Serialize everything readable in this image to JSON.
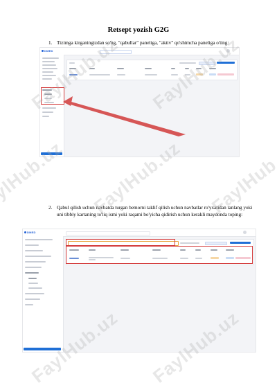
{
  "document": {
    "title": "Retsept yozish G2G",
    "steps": [
      {
        "num": "1.",
        "text": "Tizimga kirganingizdan so'ng, \"qabullar\" paneliga, \"aktiv\" qo'shimcha paneliga o'ting:"
      },
      {
        "num": "2.",
        "text": "Qabul qilish uchun navbatda turgan bemorni taklif qilish uchun navbatlar ro'yxatidan tanlang yoki uni tibbiy kartaning to'liq ismi yoki raqami bo'yicha qidirish uchun kerakli maydonda toping:"
      }
    ]
  },
  "watermark": {
    "text": "FaylHub.uz"
  },
  "screenshots": {
    "logo": "DMED"
  },
  "colors": {
    "accent": "#1f6fd6",
    "highlight": "#d33a3a"
  }
}
